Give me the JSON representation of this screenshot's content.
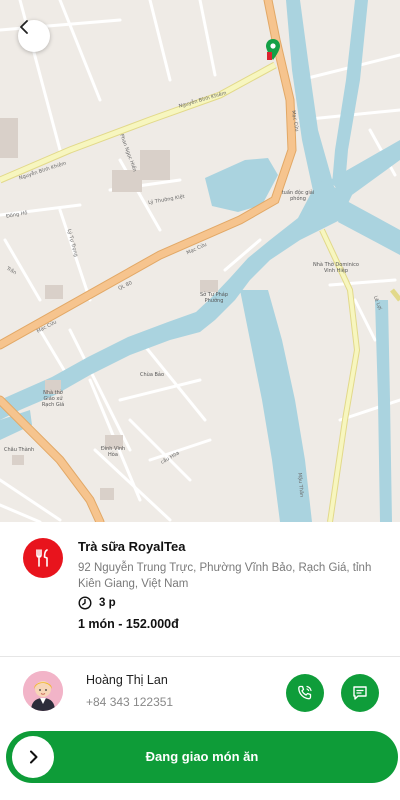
{
  "map": {
    "labels": {
      "nguyen_binh_khiem_1": "Nguyễn Bỉnh Khiêm",
      "nguyen_binh_khiem_2": "Nguyễn Bỉnh Khiêm",
      "mac_cuu_1": "Mạc Cửu",
      "mac_cuu_2": "Mạc Cửu",
      "mac_cuu_3": "Mạc Cửu",
      "ql80": "QL 80",
      "phan_ngoc_hien": "Phan Ngọc Hiển",
      "ly_thuong_kiet": "Lý Thường Kiệt",
      "ly_tu_trong": "Lý Tự Trọng",
      "dong_ho": "Đống Hồ",
      "tran": "Trần",
      "mau_than": "Mậu Thân",
      "le_loi": "Lê Lợi",
      "cau_hoa": "cầu Hòa",
      "nha_tho": "Nhà Thờ Dominico Vinh Hiệp",
      "den_doc_giai_phong": "tuấn độc giải phóng",
      "so_tu_phap": "Sở Tư Pháp Phường",
      "chua_bao": "Chùa Bảo",
      "chau_thanh": "Châu Thành",
      "dinh_vinh_hoa": "Đình Vĩnh Hòa",
      "nha_tho_giao_xu": "Nhà thờ Giáo xứ Rạch Giá"
    }
  },
  "restaurant": {
    "name": "Trà sữa RoyalTea",
    "address": "92 Nguyễn Trung Trực, Phường Vĩnh Bảo, Rạch Giá, tỉnh Kiên Giang, Việt Nam",
    "eta": "3 p",
    "order_summary": "1 món - 152.000đ"
  },
  "customer": {
    "name": "Hoàng Thị Lan",
    "phone": "+84 343 122351"
  },
  "action": {
    "label": "Đang giao món ăn"
  },
  "colors": {
    "brand_green": "#0e9c38",
    "restaurant_red": "#e8141d",
    "map_water": "#aad3df",
    "map_road_major": "#f6c48e",
    "map_road_secondary": "#f5f5b0",
    "map_land": "#efebe6"
  }
}
